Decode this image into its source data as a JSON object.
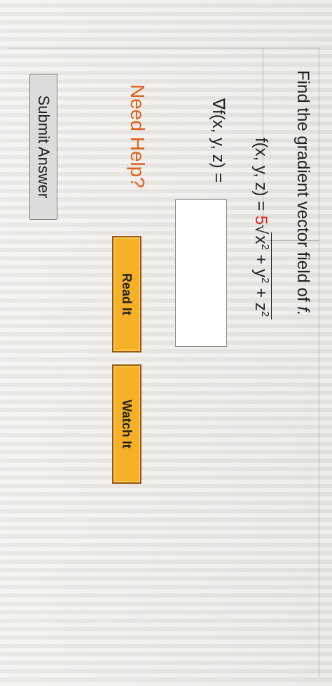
{
  "question": {
    "prompt": "Find the gradient vector field of",
    "variable": "f.",
    "function_lhs": "f(x, y, z) = ",
    "coefficient": "5",
    "radicand_x": "x",
    "radicand_y": "y",
    "radicand_z": "z",
    "exponent": "2",
    "plus": " + ",
    "gradient_label": "∇f(x, y, z) ="
  },
  "answer": {
    "value": ""
  },
  "help": {
    "heading": "Need Help?",
    "read_label": "Read It",
    "watch_label": "Watch It"
  },
  "submit": {
    "label": "Submit Answer"
  },
  "colors": {
    "accent_red": "#d6261c",
    "need_help_orange": "#e0621d",
    "help_button": "#f6b026"
  }
}
